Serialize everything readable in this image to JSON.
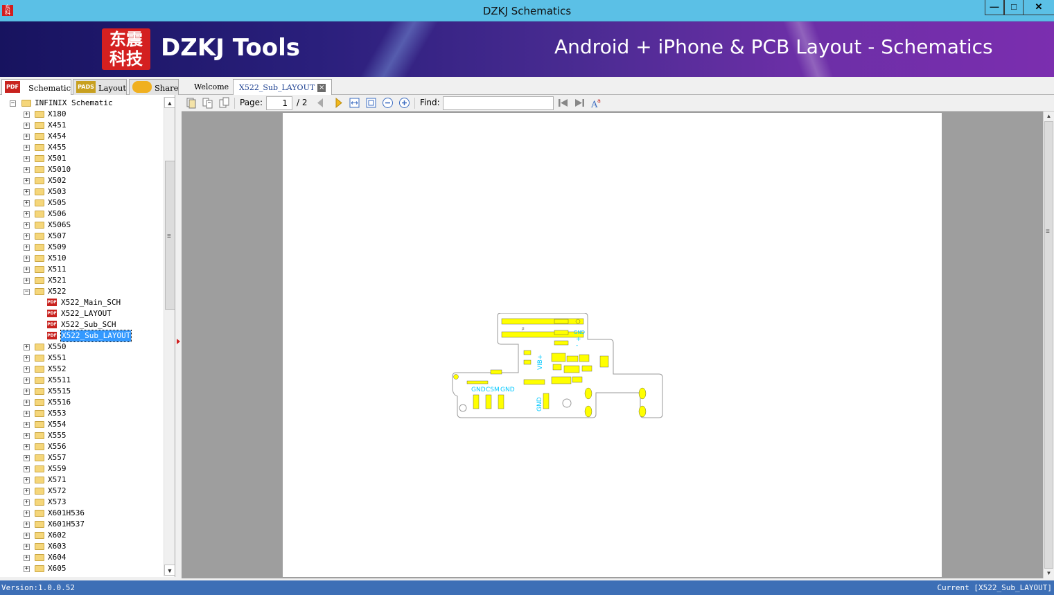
{
  "window": {
    "title": "DZKJ Schematics",
    "controls": {
      "minimize": "—",
      "maximize": "□",
      "close": "✕"
    }
  },
  "banner": {
    "logo_text_line1": "东震",
    "logo_text_line2": "科技",
    "brand": "DZKJ Tools",
    "tagline": "Android + iPhone & PCB Layout - Schematics"
  },
  "left_tabs": [
    {
      "label": "Schematic",
      "icon": "pdf-icon",
      "icon_text": "PDF"
    },
    {
      "label": "Layout",
      "icon": "pads-icon",
      "icon_text": "PADS"
    },
    {
      "label": "Share",
      "icon": "cloud-share-icon",
      "icon_text": ""
    }
  ],
  "doc_tabs": [
    {
      "label": "Welcome"
    },
    {
      "label": "X522_Sub_LAYOUT",
      "close": "×"
    }
  ],
  "tree": {
    "root": "INFINIX Schematic",
    "folders_before": [
      "X180",
      "X451",
      "X454",
      "X455",
      "X501",
      "X5010",
      "X502",
      "X503",
      "X505",
      "X506",
      "X506S",
      "X507",
      "X509",
      "X510",
      "X511",
      "X521"
    ],
    "expanded_folder": "X522",
    "expanded_children": [
      "X522_Main_SCH",
      "X522_LAYOUT",
      "X522_Sub_SCH",
      "X522_Sub_LAYOUT"
    ],
    "selected_child": "X522_Sub_LAYOUT",
    "folders_after": [
      "X550",
      "X551",
      "X552",
      "X5511",
      "X5515",
      "X5516",
      "X553",
      "X554",
      "X555",
      "X556",
      "X557",
      "X559",
      "X571",
      "X572",
      "X573",
      "X601H536",
      "X601H537",
      "X602",
      "X603",
      "X604",
      "X605"
    ]
  },
  "viewer_toolbar": {
    "page_label": "Page:",
    "page_current": "1",
    "page_total": "/ 2",
    "find_label": "Find:",
    "find_value": ""
  },
  "pcb_labels": {
    "gnd1": "GND",
    "csm": "CSM",
    "gnd2": "GND",
    "gnd3": "GND",
    "gnd4": "GND",
    "vib": "VIB+",
    "vib_minus": "-"
  },
  "statusbar": {
    "version": "Version:1.0.0.52",
    "current": "Current [X522_Sub_LAYOUT]"
  },
  "colors": {
    "titlebar": "#5bc0e6",
    "statusbar": "#3d6fb6",
    "selection": "#3399ff",
    "pcb_pad": "#ffff00",
    "pcb_text": "#00c8ff"
  }
}
